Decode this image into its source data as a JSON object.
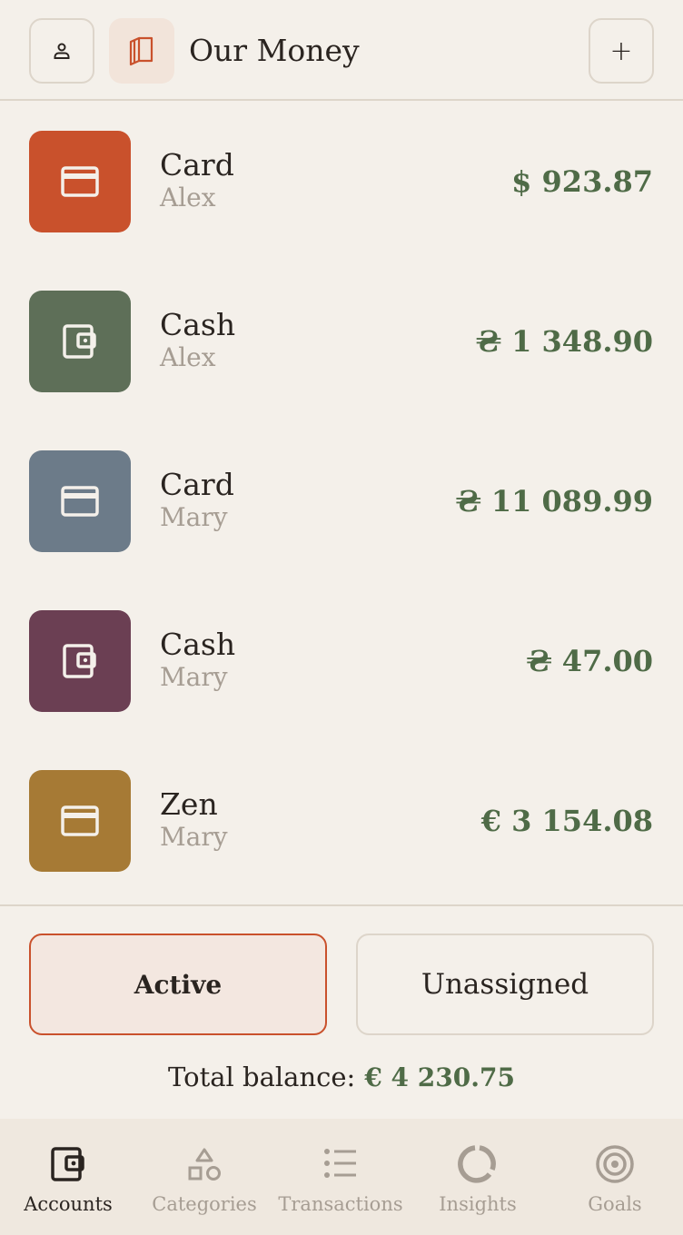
{
  "header": {
    "title": "Our Money",
    "add_label": "+"
  },
  "accounts": [
    {
      "name": "Card",
      "owner": "Alex",
      "amount": "$ 923.87",
      "type": "card",
      "color": "#c9512c"
    },
    {
      "name": "Cash",
      "owner": "Alex",
      "amount": "₴ 1 348.90",
      "type": "wallet",
      "color": "#5e6f58"
    },
    {
      "name": "Card",
      "owner": "Mary",
      "amount": "₴ 11 089.99",
      "type": "card",
      "color": "#6c7b89"
    },
    {
      "name": "Cash",
      "owner": "Mary",
      "amount": "₴ 47.00",
      "type": "wallet",
      "color": "#6b3f53"
    },
    {
      "name": "Zen",
      "owner": "Mary",
      "amount": "€ 3 154.08",
      "type": "card",
      "color": "#a67a35"
    }
  ],
  "filters": {
    "active": "Active",
    "unassigned": "Unassigned"
  },
  "total": {
    "label": "Total balance:",
    "value": "€ 4 230.75"
  },
  "nav": [
    {
      "label": "Accounts",
      "icon": "wallet-icon",
      "current": true
    },
    {
      "label": "Categories",
      "icon": "shapes-icon",
      "current": false
    },
    {
      "label": "Transactions",
      "icon": "list-icon",
      "current": false
    },
    {
      "label": "Insights",
      "icon": "donut-icon",
      "current": false
    },
    {
      "label": "Goals",
      "icon": "target-icon",
      "current": false
    }
  ],
  "colors": {
    "accent": "#c9512c",
    "amount": "#4f6b47",
    "muted": "#a69d93",
    "background": "#f4f0ea"
  }
}
